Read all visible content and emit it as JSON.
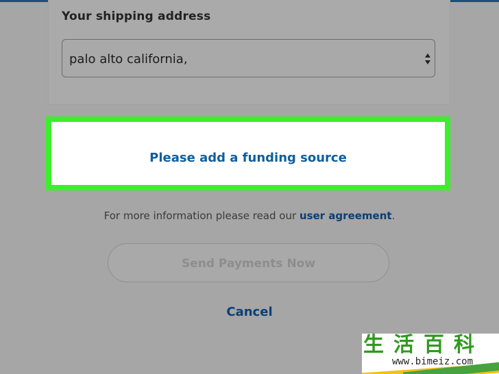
{
  "shipping": {
    "label": "Your shipping address",
    "selected_value": "palo alto california,"
  },
  "funding": {
    "link_label": "Please add a funding source",
    "highlight_color": "#3bef2a"
  },
  "info": {
    "prefix": "For more information please read our ",
    "link_label": "user agreement",
    "suffix": "."
  },
  "send_button": {
    "label": "Send Payments Now"
  },
  "cancel": {
    "label": "Cancel"
  },
  "watermark": {
    "chars": "生活百科",
    "url": "www.bimeiz.com"
  },
  "colors": {
    "link_blue": "#0f5e9c",
    "dark_blue": "#0b3f73",
    "overlay_gray": "#a6a6a6"
  }
}
